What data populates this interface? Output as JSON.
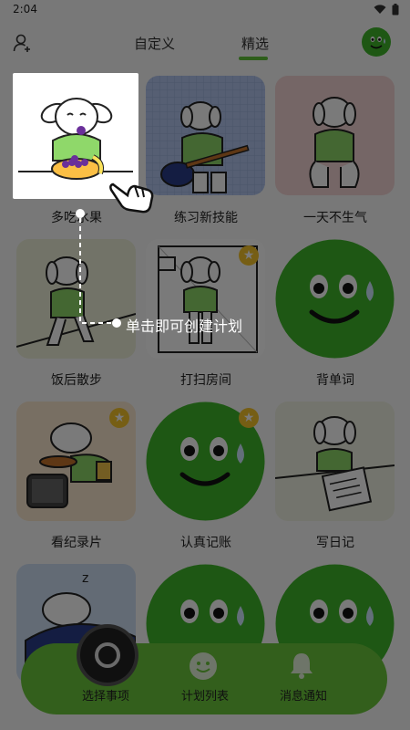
{
  "status": {
    "time": "2:04"
  },
  "tabs": [
    {
      "label": "自定义"
    },
    {
      "label": "精选"
    }
  ],
  "grid": {
    "items": [
      {
        "label": "多吃水果",
        "starred": false
      },
      {
        "label": "练习新技能",
        "starred": false
      },
      {
        "label": "一天不生气",
        "starred": false
      },
      {
        "label": "饭后散步",
        "starred": false
      },
      {
        "label": "打扫房间",
        "starred": true
      },
      {
        "label": "背单词",
        "starred": false
      },
      {
        "label": "看纪录片",
        "starred": true
      },
      {
        "label": "认真记账",
        "starred": true
      },
      {
        "label": "写日记",
        "starred": false
      }
    ]
  },
  "guide": {
    "hint": "单击即可创建计划"
  },
  "bottom_nav": [
    {
      "label": "选择事项"
    },
    {
      "label": "计划列表"
    },
    {
      "label": "消息通知"
    }
  ],
  "colors": {
    "accent": "#61c43a",
    "nav_bg": "#6cc73c",
    "overlay": "rgba(0,0,0,0.52)"
  }
}
